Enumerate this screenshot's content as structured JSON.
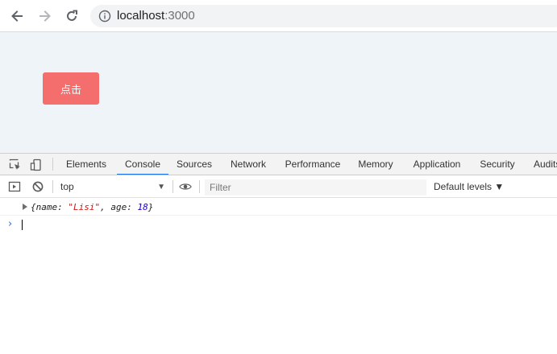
{
  "browser": {
    "url_host": "localhost",
    "url_port": ":3000"
  },
  "page": {
    "click_button_label": "点击"
  },
  "devtools": {
    "tabs": [
      "Elements",
      "Console",
      "Sources",
      "Network",
      "Performance",
      "Memory",
      "Application",
      "Security",
      "Audits"
    ],
    "active_tab": "Console",
    "context": "top",
    "filter_placeholder": "Filter",
    "levels_label": "Default levels ▼",
    "log": {
      "open": "{name: ",
      "name_value": "\"Lisi\"",
      "mid": ", age: ",
      "age_value": "18",
      "close": "}"
    },
    "prompt_symbol": "›"
  },
  "colors": {
    "accent": "#1a73e8",
    "button": "#f56e6e",
    "viewport_bg": "#eef4f7"
  }
}
